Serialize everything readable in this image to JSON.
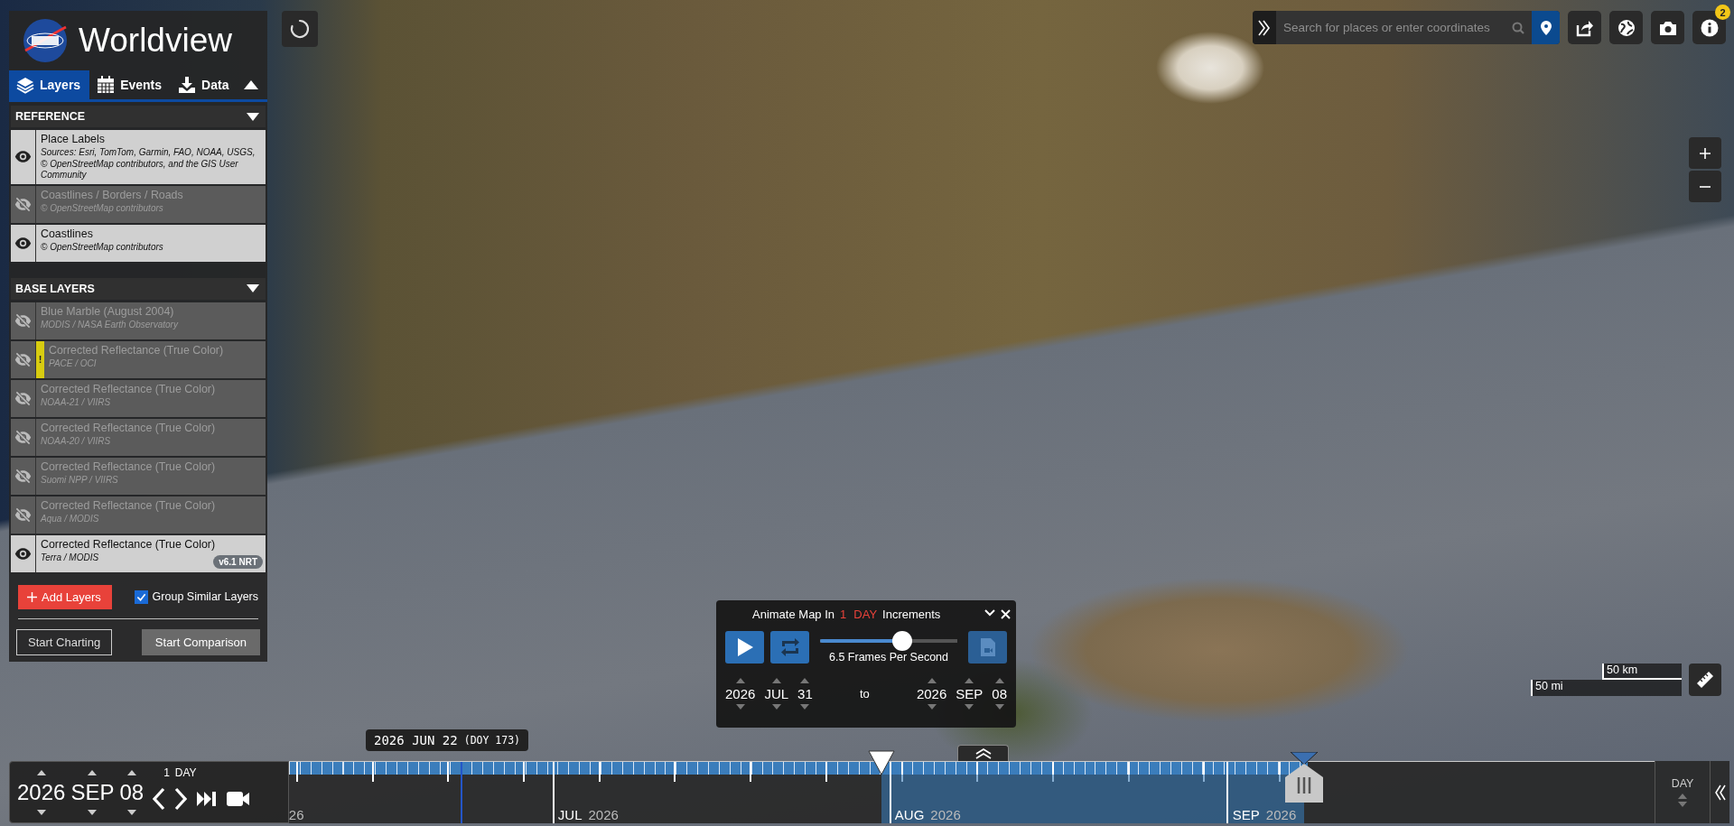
{
  "header": {
    "title": "Worldview"
  },
  "tabs": [
    {
      "label": "Layers",
      "selected": true
    },
    {
      "label": "Events",
      "selected": false
    },
    {
      "label": "Data",
      "selected": false
    }
  ],
  "layer_groups": [
    {
      "title": "REFERENCE",
      "layers": [
        {
          "name": "Place Labels",
          "source": "Sources: Esri, TomTom, Garmin, FAO, NOAA, USGS, © OpenStreetMap contributors, and the GIS User Community",
          "visible": true
        },
        {
          "name": "Coastlines / Borders / Roads",
          "source": "© OpenStreetMap contributors",
          "visible": false
        },
        {
          "name": "Coastlines",
          "source": "© OpenStreetMap contributors",
          "visible": true
        }
      ]
    },
    {
      "title": "BASE LAYERS",
      "layers": [
        {
          "name": "Blue Marble (August 2004)",
          "source": "MODIS / NASA Earth Observatory",
          "visible": false
        },
        {
          "name": "Corrected Reflectance (True Color)",
          "source": "PACE / OCI",
          "visible": false,
          "warning": "!"
        },
        {
          "name": "Corrected Reflectance (True Color)",
          "source": "NOAA-21 / VIIRS",
          "visible": false
        },
        {
          "name": "Corrected Reflectance (True Color)",
          "source": "NOAA-20 / VIIRS",
          "visible": false
        },
        {
          "name": "Corrected Reflectance (True Color)",
          "source": "Suomi NPP / VIIRS",
          "visible": false
        },
        {
          "name": "Corrected Reflectance (True Color)",
          "source": "Aqua / MODIS",
          "visible": false
        },
        {
          "name": "Corrected Reflectance (True Color)",
          "source": "Terra / MODIS",
          "visible": true,
          "badge": "v6.1 NRT"
        }
      ]
    }
  ],
  "add_layers_button": "Add Layers",
  "group_similar": {
    "label": "Group Similar Layers",
    "checked": true
  },
  "panel_buttons": [
    {
      "label": "Start Charting",
      "kind": "outline"
    },
    {
      "label": "Start Comparison",
      "kind": "filled"
    }
  ],
  "search": {
    "placeholder": "Search for places or enter coordinates"
  },
  "notification_count": "2",
  "animation": {
    "prefix": "Animate Map In",
    "step": "1",
    "unit": "DAY",
    "suffix": "Increments",
    "speed": {
      "level": 0.6,
      "reading": "6.5 Frames Per Second"
    },
    "start": {
      "year": "2026",
      "month": "JUL",
      "day": "31"
    },
    "separator": "to",
    "end": {
      "year": "2026",
      "month": "SEP",
      "day": "08"
    }
  },
  "hover_date": {
    "date": "2026 JUN 22",
    "doy": "(DOY 173)"
  },
  "date": {
    "year": "2026",
    "month": "SEP",
    "day": "08"
  },
  "interval": {
    "step": "1",
    "unit": "DAY"
  },
  "timeline": {
    "axis_labels": [
      {
        "year": "26"
      },
      {
        "month": "JUL",
        "year": "2026"
      },
      {
        "month": "AUG",
        "year": "2026"
      },
      {
        "month": "SEP",
        "year": "2026"
      }
    ],
    "zoom_level": "DAY"
  },
  "scale": {
    "metric": "50 km",
    "imperial": "50 mi"
  }
}
